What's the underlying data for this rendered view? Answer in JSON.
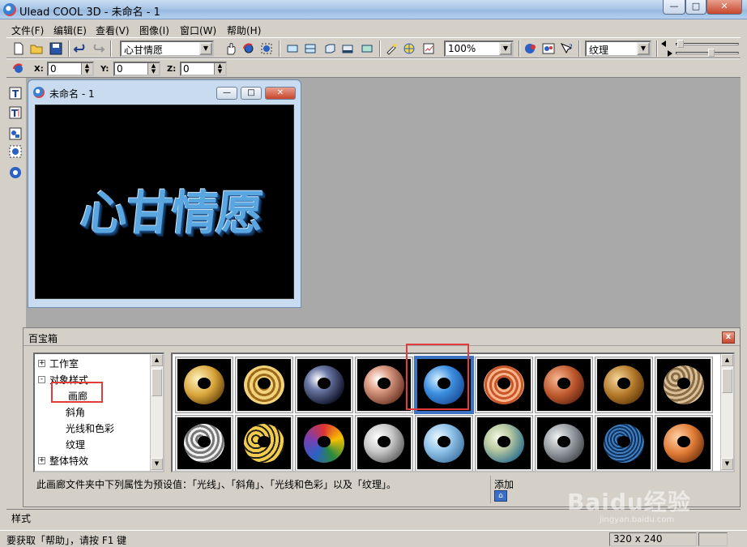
{
  "window": {
    "title": "Ulead COOL 3D - 未命名 - 1",
    "controls": {
      "minimize": "—",
      "maximize": "□",
      "close": "✕"
    }
  },
  "menu": [
    "文件(F)",
    "编辑(E)",
    "查看(V)",
    "图像(I)",
    "窗口(W)",
    "帮助(H)"
  ],
  "toolbar": {
    "text_object_value": "心甘情愿",
    "zoom_value": "100%",
    "attribute_value": "纹理"
  },
  "coordinates": {
    "x_label": "X:",
    "x_value": "0",
    "y_label": "Y:",
    "y_value": "0",
    "z_label": "Z:",
    "z_value": "0"
  },
  "document": {
    "title": "未命名 - 1",
    "canvas_text": "心甘情愿"
  },
  "library": {
    "title": "百宝箱",
    "close": "x",
    "tree": [
      {
        "toggle": "+",
        "label": "工作室"
      },
      {
        "toggle": "-",
        "label": "对象样式"
      },
      {
        "toggle": "",
        "label": "画廊",
        "selected": true
      },
      {
        "toggle": "",
        "label": "斜角"
      },
      {
        "toggle": "",
        "label": "光线和色彩"
      },
      {
        "toggle": "",
        "label": "纹理"
      },
      {
        "toggle": "+",
        "label": "整体特效"
      }
    ],
    "thumbnails_row1": [
      "gold",
      "gold-ridged",
      "dark-chrome",
      "copper",
      "blue-marble",
      "orange-rings",
      "terracotta",
      "gold-holes",
      "bronze-dots"
    ],
    "thumbnails_row2": [
      "steel-holes",
      "leopard",
      "rainbow",
      "silver",
      "sky-blue",
      "green-chrome",
      "steel-bolt",
      "blue-dotted",
      "copper-plain"
    ],
    "selected_index": 4,
    "description": "此画廊文件夹中下列属性为预设值：「光线」、「斜角」、「光线和色彩」以及「纹理」。",
    "add_label": "添加"
  },
  "tabs": {
    "styles_tab": "样式"
  },
  "status": {
    "help_text": "要获取「帮助」，请按 F1 键",
    "dimensions": "320 x 240"
  },
  "watermark": {
    "brand": "Baidu经验",
    "url": "jingyan.baidu.com"
  }
}
